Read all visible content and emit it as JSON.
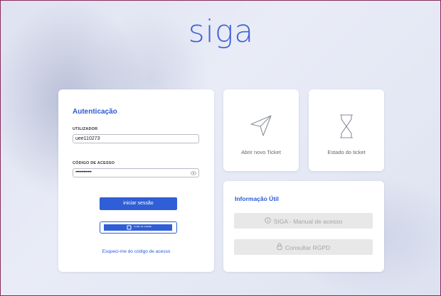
{
  "header": {
    "logo_text": "siga"
  },
  "auth": {
    "title": "Autenticação",
    "username_label": "UTILIZADOR",
    "username_value": "uee110273",
    "password_label": "CÓDIGO DE ACESSO",
    "password_value": "••••••••••••••",
    "login_button": "iniciar sessão",
    "cc_button_text": "Cartão de Cidadão",
    "forgot_link": "Esqueci-me do código de acesso"
  },
  "tickets": {
    "new_ticket_label": "Abrir novo Ticket",
    "ticket_status_label": "Estado do ticket"
  },
  "info": {
    "title": "Informação Útil",
    "manual_button": "SIGA - Manual de acesso",
    "rgpd_button": "Consultar RGPD"
  },
  "icons": {
    "new_ticket": "paper-plane-icon",
    "ticket_status": "hourglass-icon",
    "password_toggle": "eye-icon",
    "manual": "info-circle-icon",
    "rgpd": "lock-icon"
  },
  "colors": {
    "accent": "#2f5ed6",
    "logo": "#3f62d6",
    "frame_border": "#8a2a5c"
  }
}
